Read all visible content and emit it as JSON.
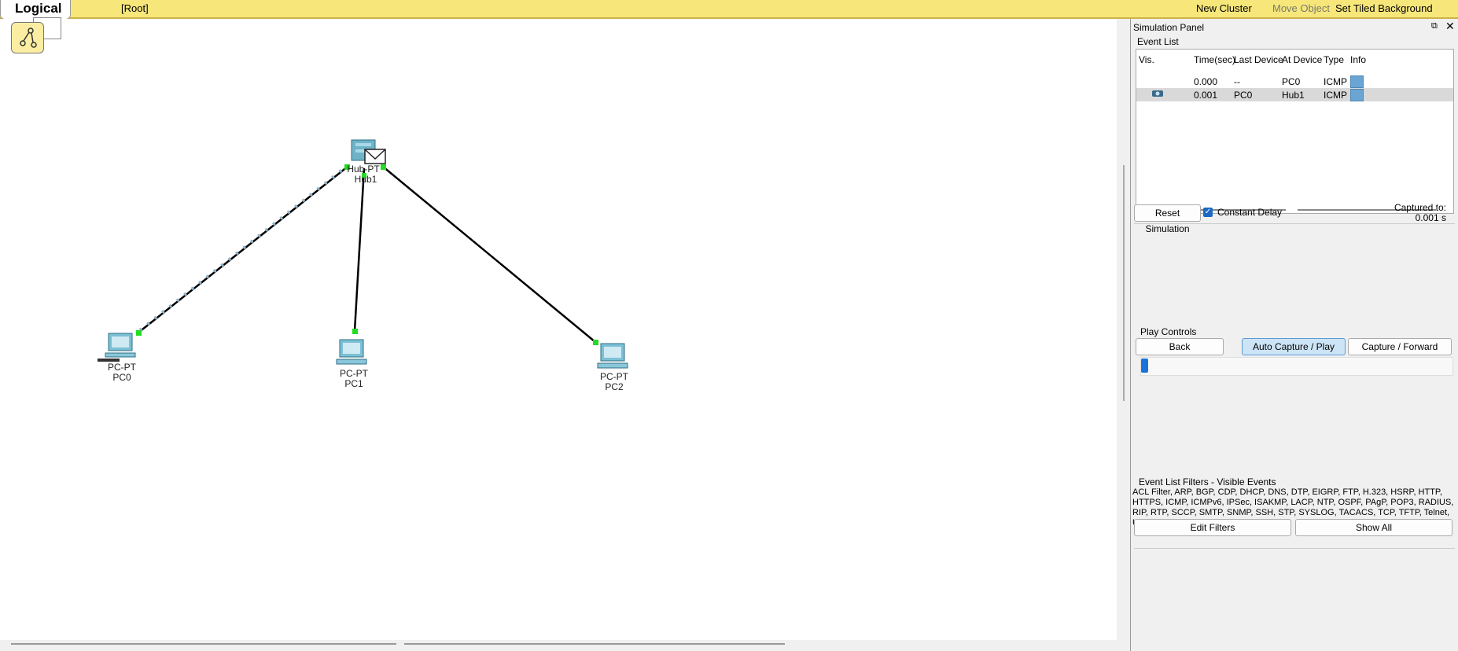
{
  "topbar": {
    "logical_label": "Logical",
    "root_label": "[Root]",
    "new_cluster": "New Cluster",
    "move_object": "Move Object",
    "set_tiled_background": "Set Tiled Background"
  },
  "topology": {
    "devices": [
      {
        "type": "PC-PT",
        "name": "PC0"
      },
      {
        "type": "PC-PT",
        "name": "PC1"
      },
      {
        "type": "PC-PT",
        "name": "PC2"
      },
      {
        "type": "Hub-PT",
        "name": "Hub1"
      }
    ],
    "link_color": "#000000",
    "port_color": "#22dd22"
  },
  "simulation_panel": {
    "title": "Simulation Panel",
    "event_list": {
      "label": "Event List",
      "columns": [
        "Vis.",
        "Time(sec)",
        "Last Device",
        "At Device",
        "Type",
        "Info"
      ],
      "rows": [
        {
          "time": "0.000",
          "last_device": "--",
          "at_device": "PC0",
          "type": "ICMP",
          "selected": false
        },
        {
          "time": "0.001",
          "last_device": "PC0",
          "at_device": "Hub1",
          "type": "ICMP",
          "selected": true
        }
      ]
    },
    "reset_simulation": "Reset Simulation",
    "constant_delay": "Constant Delay",
    "constant_delay_checked": true,
    "captured_to_label": "Captured to:",
    "captured_to_value": "0.001 s",
    "play_controls": {
      "label": "Play Controls",
      "back": "Back",
      "auto_capture_play": "Auto Capture / Play",
      "capture_forward": "Capture / Forward"
    },
    "filters": {
      "label": "Event List Filters - Visible Events",
      "visible_events": "ACL Filter, ARP, BGP, CDP, DHCP, DNS, DTP, EIGRP, FTP, H.323, HSRP, HTTP, HTTPS, ICMP, ICMPv6, IPSec, ISAKMP, LACP, NTP, OSPF, PAgP, POP3, RADIUS, RIP, RTP, SCCP, SMTP, SNMP, SSH, STP, SYSLOG, TACACS, TCP, TFTP, Telnet, UDP, VTP",
      "edit_filters": "Edit Filters",
      "show_all": "Show All"
    }
  }
}
